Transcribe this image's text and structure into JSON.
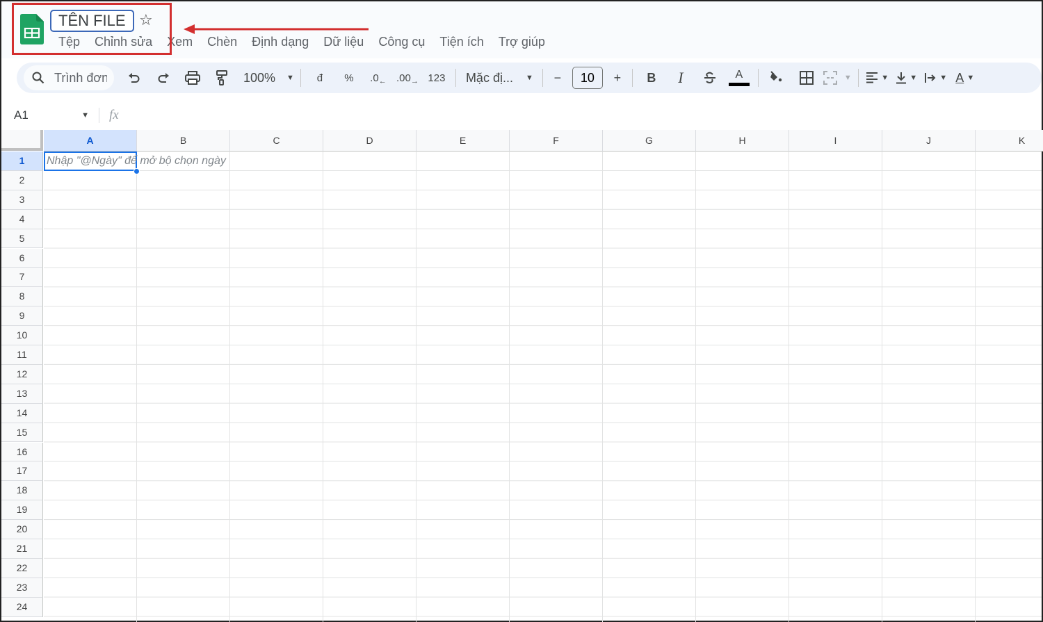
{
  "app": {
    "title": "TÊN FILE",
    "brand_color": "#1fa463",
    "menu": [
      "Tệp",
      "Chỉnh sửa",
      "Xem",
      "Chèn",
      "Định dạng",
      "Dữ liệu",
      "Công cụ",
      "Tiện ích",
      "Trợ giúp"
    ]
  },
  "annotation": {
    "color": "#d32f2f",
    "target": "file-title"
  },
  "toolbar": {
    "search_label": "Trình đơn",
    "zoom": "100%",
    "currency": "đ",
    "percent": "%",
    "decrease_decimal": ".0",
    "increase_decimal": ".00",
    "more_formats": "123",
    "font": "Mặc đị...",
    "font_size": "10",
    "minus": "−",
    "plus": "+",
    "bold": "B",
    "italic": "I",
    "text_color_glyph": "A",
    "rotate_glyph": "A"
  },
  "formula_bar": {
    "cell_ref": "A1",
    "fx_label": "fx",
    "value": ""
  },
  "sheet": {
    "columns": [
      "A",
      "B",
      "C",
      "D",
      "E",
      "F",
      "G",
      "H",
      "I",
      "J",
      "K"
    ],
    "rows": [
      "1",
      "2",
      "3",
      "4",
      "5",
      "6",
      "7",
      "8",
      "9",
      "10",
      "11",
      "12",
      "13",
      "14",
      "15",
      "16",
      "17",
      "18",
      "19",
      "20",
      "21",
      "22",
      "23",
      "24"
    ],
    "selected_cell": "A1",
    "hint_text": "Nhập \"@Ngày\" để mở bộ chọn ngày"
  }
}
